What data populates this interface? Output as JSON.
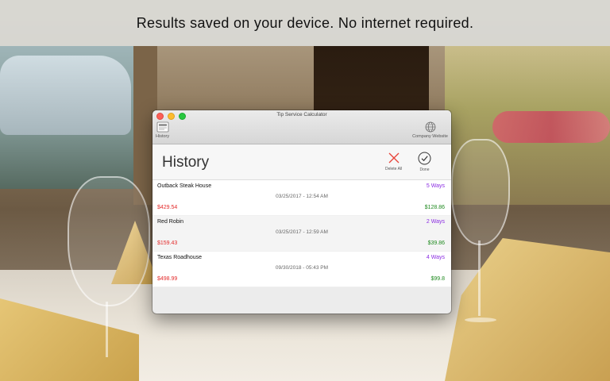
{
  "banner": {
    "text": "Results saved on your device. No internet required."
  },
  "window": {
    "title": "Tip Service Calculator",
    "toolbar": {
      "history_label": "History",
      "website_label": "Company Website"
    }
  },
  "header": {
    "title": "History",
    "delete_all_label": "Delete All",
    "done_label": "Done"
  },
  "entries": [
    {
      "name": "Outback Steak House",
      "ways": "5 Ways",
      "date": "03/25/2017 - 12:54 AM",
      "total": "$429.54",
      "tip": "$128.86"
    },
    {
      "name": "Red Robin",
      "ways": "2 Ways",
      "date": "03/25/2017 - 12:59 AM",
      "total": "$159.43",
      "tip": "$39.86"
    },
    {
      "name": "Texas Roadhouse",
      "ways": "4 Ways",
      "date": "09/30/2018 - 05:43 PM",
      "total": "$498.99",
      "tip": "$99.8"
    }
  ],
  "colors": {
    "ways": "#8a2be2",
    "total": "#e32b2b",
    "tip": "#1f8a1f",
    "delete_icon": "#e8443a"
  },
  "icons": {
    "history": "history-icon",
    "website": "globe-icon",
    "delete_all": "x-icon",
    "done": "checkmark-circle-icon"
  }
}
